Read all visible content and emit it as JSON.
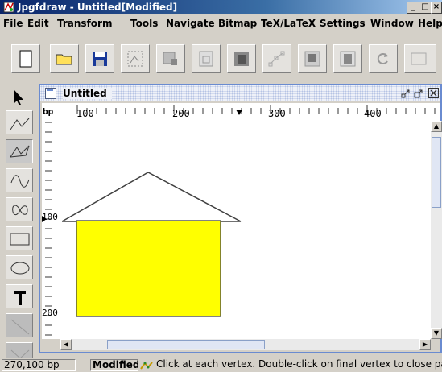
{
  "window": {
    "title": "Jpgfdraw - Untitled[Modified]",
    "minimize_label": "_",
    "maximize_label": "□",
    "close_label": "×"
  },
  "menu": [
    "File",
    "Edit",
    "Transform",
    "Tools",
    "Navigate",
    "Bitmap",
    "TeX/LaTeX",
    "Settings",
    "Window",
    "Help"
  ],
  "document": {
    "title": "Untitled",
    "ruler_unit": "bp",
    "hruler_labels": [
      "100",
      "200",
      "300",
      "400"
    ],
    "vruler_labels": [
      "100",
      "200"
    ]
  },
  "drawing": {
    "fill_color": "#ffff00",
    "stroke_color": "#404040"
  },
  "status": {
    "coords": "270,100 bp",
    "modified": "Modified",
    "hint": "Click at each vertex. Double-click on final vertex to close path"
  }
}
